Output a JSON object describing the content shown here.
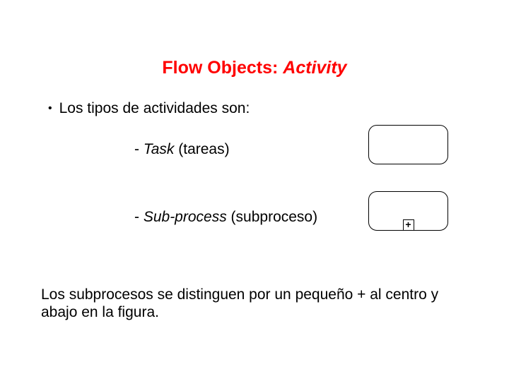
{
  "title": {
    "prefix": "Flow Objects: ",
    "activity": "Activity"
  },
  "bullet": "Los tipos de actividades son:",
  "items": {
    "task": {
      "label": "Task",
      "paren": " (tareas)"
    },
    "subprocess": {
      "label": "Sub-process",
      "paren": " (subproceso)"
    }
  },
  "subprocess_marker": "+",
  "footer": "Los subprocesos se distinguen por un pequeño + al centro y abajo en la figura."
}
